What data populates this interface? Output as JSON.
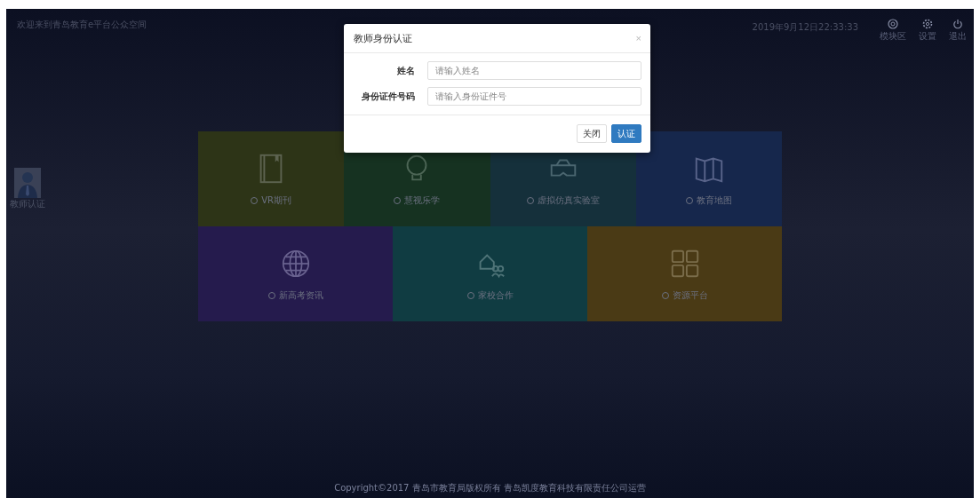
{
  "header": {
    "title": "欢迎来到青岛教育e平台公众空间",
    "datetime": "2019年9月12日22:33:33",
    "actions": [
      {
        "label": "模块区"
      },
      {
        "label": "设置"
      },
      {
        "label": "退出"
      }
    ]
  },
  "side_badge": {
    "label": "教师认证"
  },
  "tile_rows": [
    [
      {
        "label": "VR期刊",
        "color": "#2d3417"
      },
      {
        "label": "慧视乐学",
        "color": "#163221"
      },
      {
        "label": "虚拟仿真实验室",
        "color": "#15303b"
      },
      {
        "label": "教育地图",
        "color": "#16274c"
      }
    ],
    [
      {
        "label": "新高考资讯",
        "color": "#251b4d"
      },
      {
        "label": "家校合作",
        "color": "#103c42"
      },
      {
        "label": "资源平台",
        "color": "#4a3a15"
      }
    ]
  ],
  "modal": {
    "title": "教师身份认证",
    "close": "×",
    "fields": [
      {
        "label": "姓名",
        "placeholder": "请输入姓名"
      },
      {
        "label": "身份证件号码",
        "placeholder": "请输入身份证件号"
      }
    ],
    "buttons": [
      {
        "label": "关闭",
        "kind": "secondary"
      },
      {
        "label": "认证",
        "kind": "primary"
      }
    ]
  },
  "footer": "Copyright©2017 青岛市教育局版权所有 青岛凯度教育科技有限责任公司运营"
}
